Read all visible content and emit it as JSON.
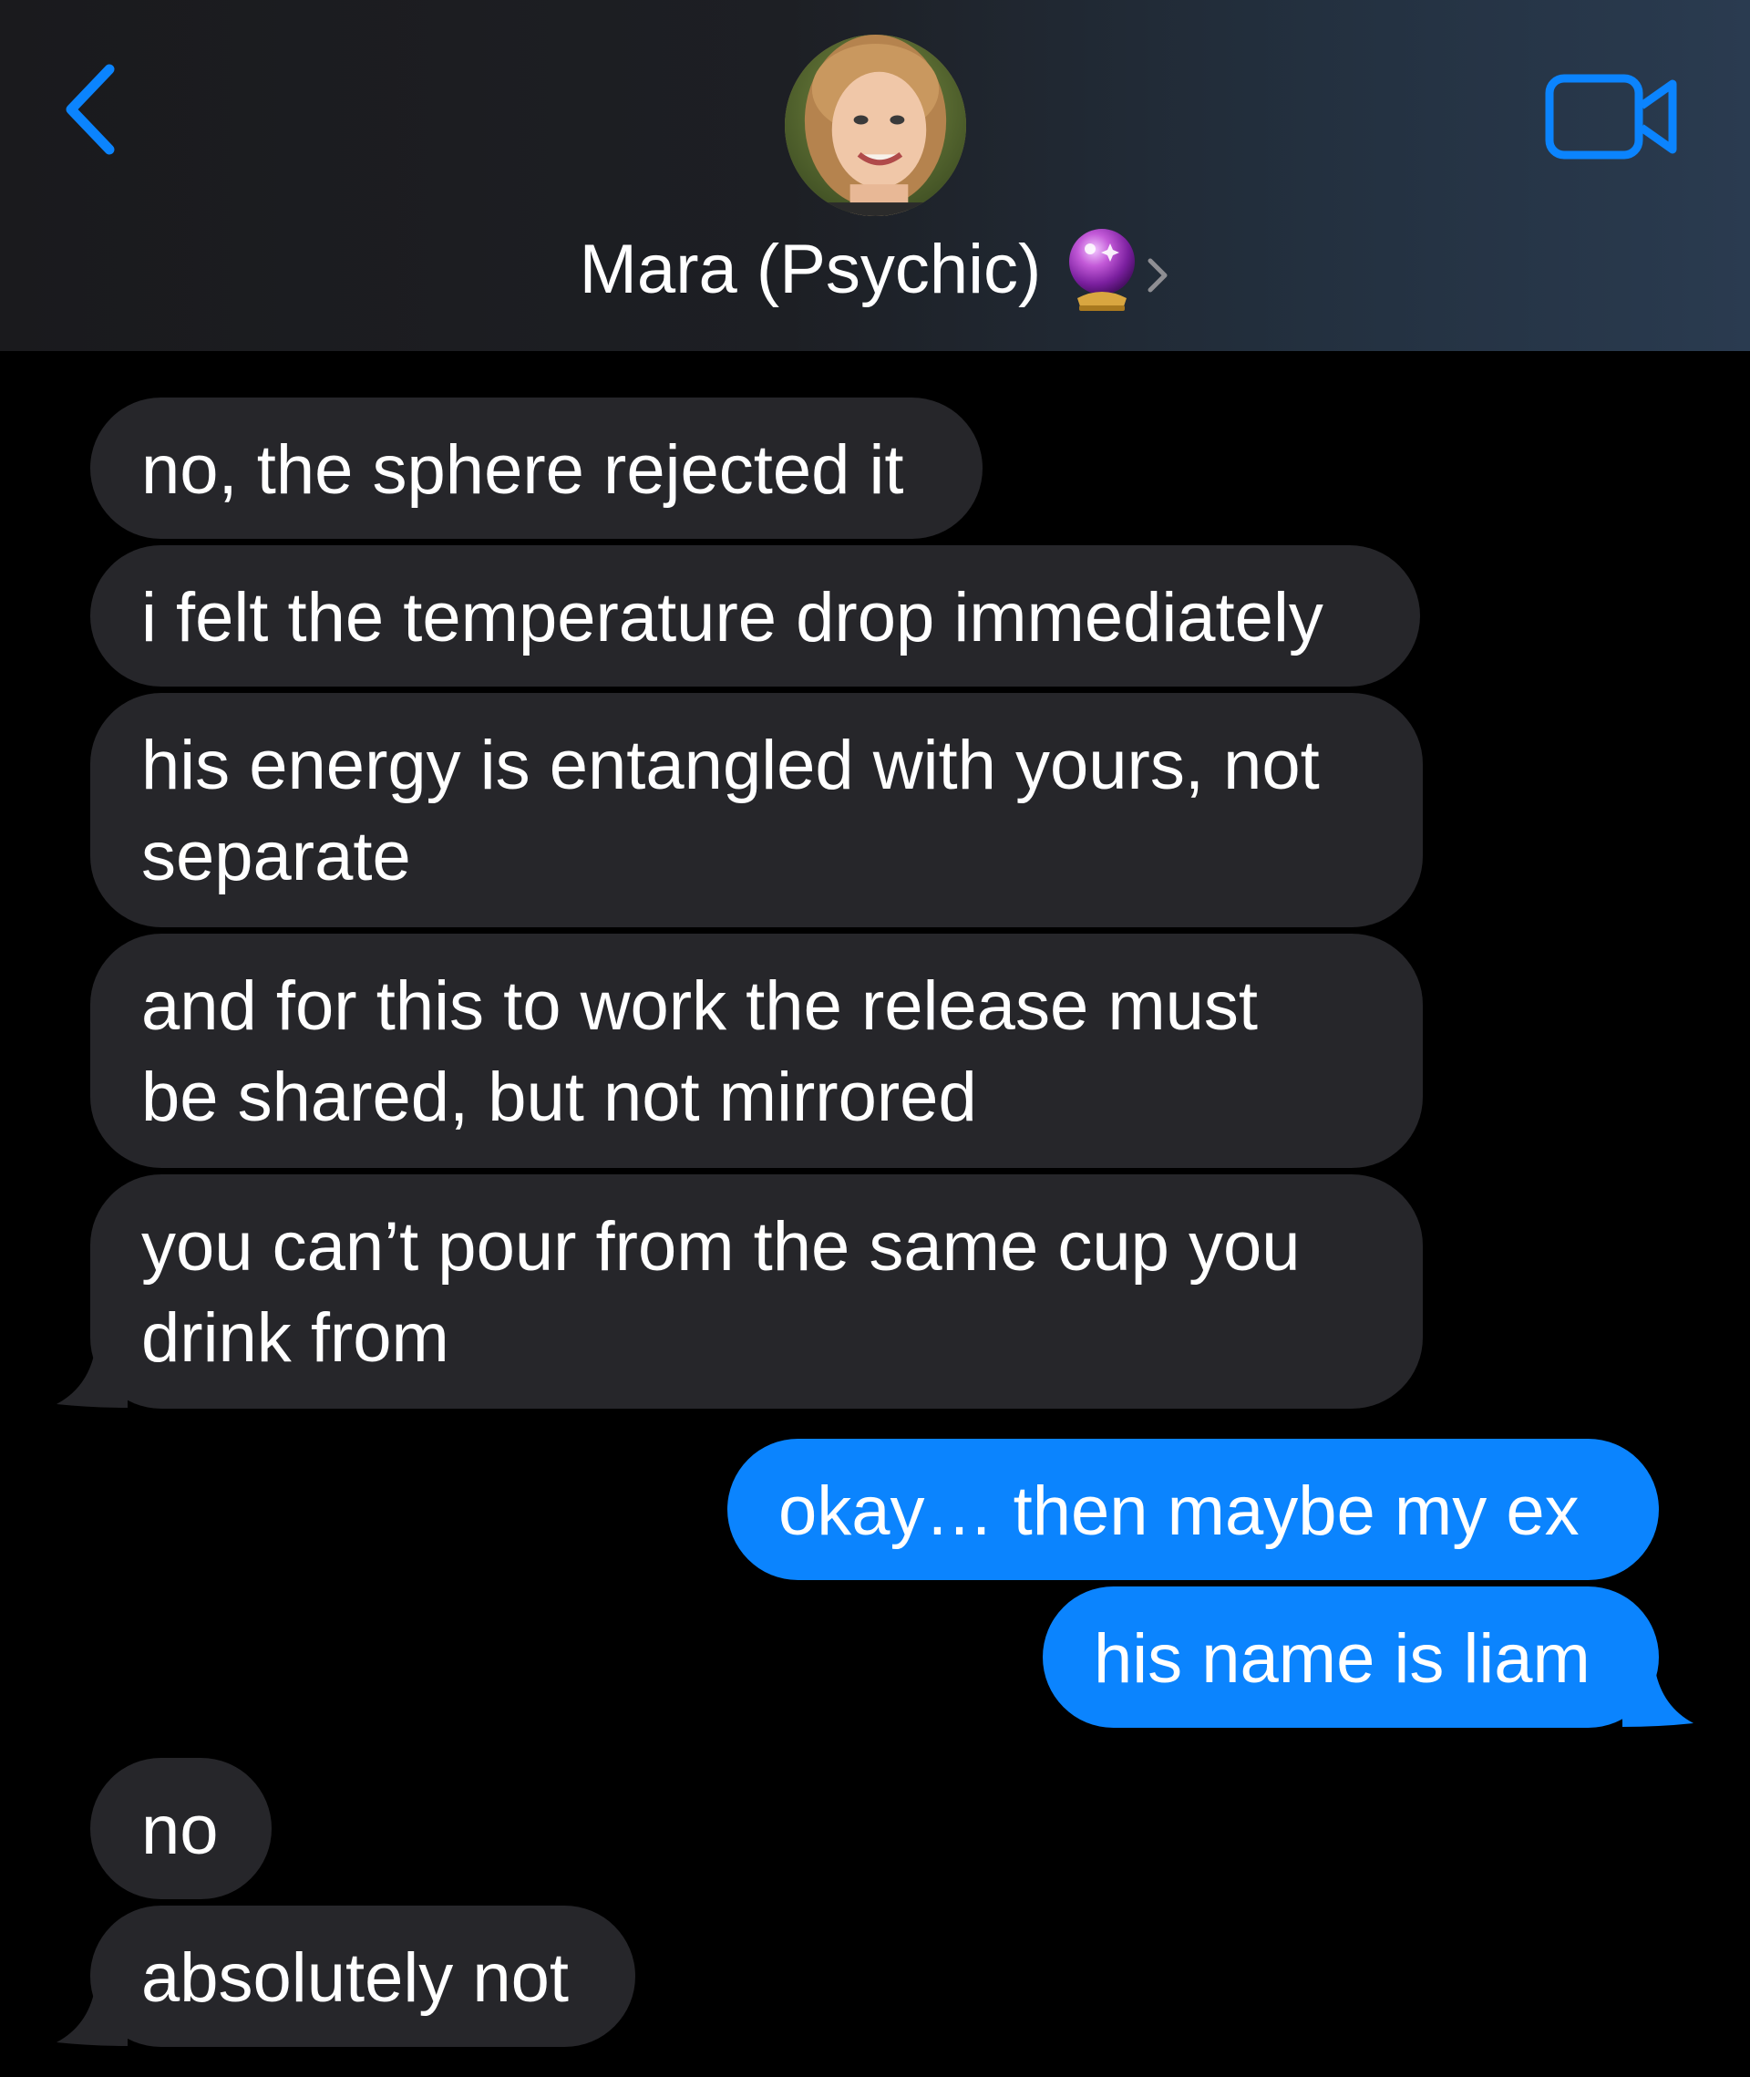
{
  "header": {
    "contact_name": "Mara (Psychic)",
    "contact_emoji": "crystal-ball-icon",
    "back_icon": "chevron-left-icon",
    "video_icon": "video-camera-icon",
    "accent_color": "#0b84fe"
  },
  "messages": [
    {
      "direction": "incoming",
      "lines": [
        "no, the sphere rejected it"
      ]
    },
    {
      "direction": "incoming",
      "lines": [
        "i felt the temperature drop immediately"
      ]
    },
    {
      "direction": "incoming",
      "lines": [
        "his energy is entangled with yours, not",
        "separate"
      ]
    },
    {
      "direction": "incoming",
      "lines": [
        "and for this to work the release must",
        "be shared, but not mirrored"
      ]
    },
    {
      "direction": "incoming",
      "lines": [
        "you can’t pour from the same cup you",
        "drink from"
      ]
    },
    {
      "direction": "outgoing",
      "lines": [
        "okay… then maybe my ex"
      ]
    },
    {
      "direction": "outgoing",
      "lines": [
        "his name is liam"
      ]
    },
    {
      "direction": "incoming",
      "lines": [
        "no"
      ]
    },
    {
      "direction": "incoming",
      "lines": [
        "absolutely not"
      ]
    }
  ],
  "colors": {
    "incoming_bubble": "#26262a",
    "outgoing_bubble": "#0b84fe",
    "background": "#000000"
  }
}
